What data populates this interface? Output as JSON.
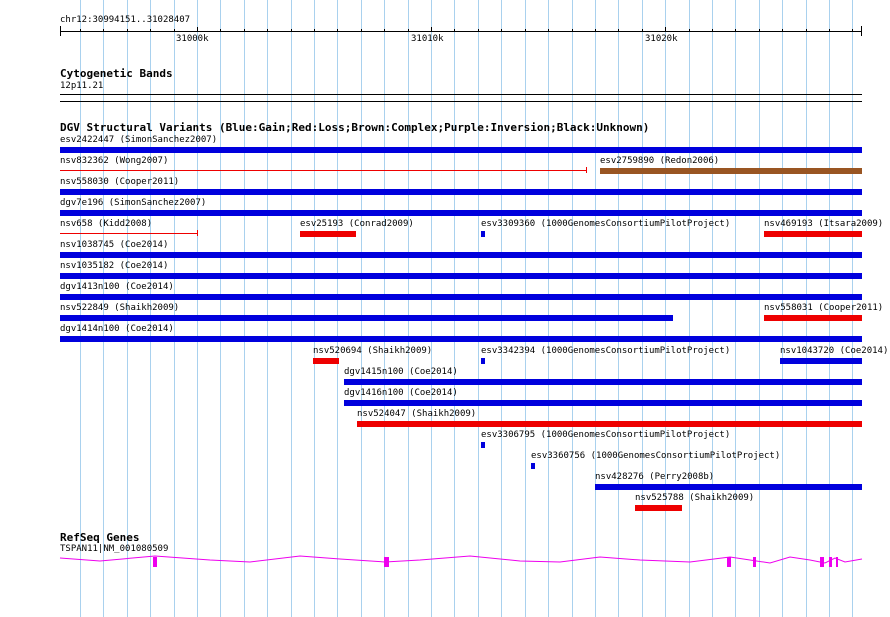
{
  "ruler": {
    "position_label": "chr12:30994151..31028407",
    "ticks": [
      "31000k",
      "31010k",
      "31020k"
    ]
  },
  "cytoband": {
    "title": "Cytogenetic Bands",
    "band_label": "12p11.21"
  },
  "dgv": {
    "title": "DGV Structural Variants (Blue:Gain;Red:Loss;Brown:Complex;Purple:Inversion;Black:Unknown)",
    "color_key": {
      "Gain": "#0000dd",
      "Loss": "#ee0000",
      "Complex": "#995522",
      "Purple": "#800080",
      "Unknown": "#000000"
    },
    "features": [
      {
        "label": "esv2422447 (SimonSanchez2007)",
        "type": "Gain",
        "start": 30994151,
        "end": 31028407
      },
      {
        "label": "nsv832362 (Wong2007)",
        "type": "Loss",
        "start": 30994151,
        "end": 31016600,
        "style": "thin"
      },
      {
        "label": "esv2759890 (Redon2006)",
        "type": "Complex",
        "start": 31017200,
        "end": 31028407
      },
      {
        "label": "nsv558030 (Cooper2011)",
        "type": "Gain",
        "start": 30994151,
        "end": 31028407
      },
      {
        "label": "dgv7e196 (SimonSanchez2007)",
        "type": "Gain",
        "start": 30994151,
        "end": 31028407
      },
      {
        "label": "nsv658 (Kidd2008)",
        "type": "Loss",
        "start": 30994151,
        "end": 31000000,
        "style": "thin"
      },
      {
        "label": "esv25193 (Conrad2009)",
        "type": "Loss",
        "start": 31004400,
        "end": 31006800
      },
      {
        "label": "esv3309360 (1000GenomesConsortiumPilotProject)",
        "type": "Gain",
        "start": 31012150,
        "end": 31012300
      },
      {
        "label": "nsv469193 (Itsara2009)",
        "type": "Loss",
        "start": 31024200,
        "end": 31028407
      },
      {
        "label": "nsv1038745 (Coe2014)",
        "type": "Gain",
        "start": 30994151,
        "end": 31028407
      },
      {
        "label": "nsv1035182 (Coe2014)",
        "type": "Gain",
        "start": 30994151,
        "end": 31028407
      },
      {
        "label": "dgv1413n100 (Coe2014)",
        "type": "Gain",
        "start": 30994151,
        "end": 31028407
      },
      {
        "label": "nsv522849 (Shaikh2009)",
        "type": "Gain",
        "start": 30994151,
        "end": 31020350
      },
      {
        "label": "nsv558031 (Cooper2011)",
        "type": "Loss",
        "start": 31024200,
        "end": 31028407
      },
      {
        "label": "dgv1414n100 (Coe2014)",
        "type": "Gain",
        "start": 30994151,
        "end": 31028407
      },
      {
        "label": "nsv520694 (Shaikh2009)",
        "type": "Loss",
        "start": 31004950,
        "end": 31006050
      },
      {
        "label": "esv3342394 (1000GenomesConsortiumPilotProject)",
        "type": "Gain",
        "start": 31012150,
        "end": 31012300
      },
      {
        "label": "nsv1043720 (Coe2014)",
        "type": "Gain",
        "start": 31024900,
        "end": 31028407
      },
      {
        "label": "dgv1415n100 (Coe2014)",
        "type": "Gain",
        "start": 31006300,
        "end": 31028407
      },
      {
        "label": "dgv1416n100 (Coe2014)",
        "type": "Gain",
        "start": 31006300,
        "end": 31028407
      },
      {
        "label": "nsv524047 (Shaikh2009)",
        "type": "Loss",
        "start": 31006850,
        "end": 31028407
      },
      {
        "label": "esv3306795 (1000GenomesConsortiumPilotProject)",
        "type": "Gain",
        "start": 31012150,
        "end": 31012300
      },
      {
        "label": "esv3360756 (1000GenomesConsortiumPilotProject)",
        "type": "Gain",
        "start": 31014250,
        "end": 31014400
      },
      {
        "label": "nsv428276 (Perry2008b)",
        "type": "Gain",
        "start": 31017000,
        "end": 31028407
      },
      {
        "label": "nsv525788 (Shaikh2009)",
        "type": "Loss",
        "start": 31018700,
        "end": 31020700
      }
    ]
  },
  "refseq": {
    "title": "RefSeq Genes",
    "gene_label": "TSPAN11|NM_001080509",
    "color": "#ee00ee"
  }
}
